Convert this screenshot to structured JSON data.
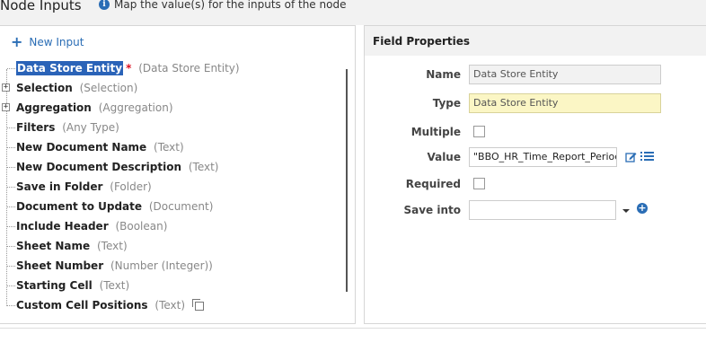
{
  "header": {
    "title": "Node Inputs",
    "info_text": "Map the value(s) for the inputs of the node"
  },
  "left": {
    "new_input_label": "New Input",
    "nodes": [
      {
        "name": "Data Store Entity",
        "type": "(Data Store Entity)",
        "required": "*"
      },
      {
        "name": "Selection",
        "type": "(Selection)"
      },
      {
        "name": "Aggregation",
        "type": "(Aggregation)"
      },
      {
        "name": "Filters",
        "type": "(Any Type)"
      },
      {
        "name": "New Document Name",
        "type": "(Text)"
      },
      {
        "name": "New Document Description",
        "type": "(Text)"
      },
      {
        "name": "Save in Folder",
        "type": "(Folder)"
      },
      {
        "name": "Document to Update",
        "type": "(Document)"
      },
      {
        "name": "Include Header",
        "type": "(Boolean)"
      },
      {
        "name": "Sheet Name",
        "type": "(Text)"
      },
      {
        "name": "Sheet Number",
        "type": "(Number (Integer))"
      },
      {
        "name": "Starting Cell",
        "type": "(Text)"
      },
      {
        "name": "Custom Cell Positions",
        "type": "(Text)"
      }
    ]
  },
  "right": {
    "title": "Field Properties",
    "name_label": "Name",
    "name_value": "Data Store Entity",
    "type_label": "Type",
    "type_value": "Data Store Entity",
    "multiple_label": "Multiple",
    "value_label": "Value",
    "value_value": "\"BBO_HR_Time_Report_Period\"",
    "required_label": "Required",
    "save_into_label": "Save into",
    "save_into_value": ""
  },
  "colors": {
    "accent": "#2a6db5",
    "selection": "#2a63b8",
    "type_field_bg": "#fbf6c5"
  }
}
